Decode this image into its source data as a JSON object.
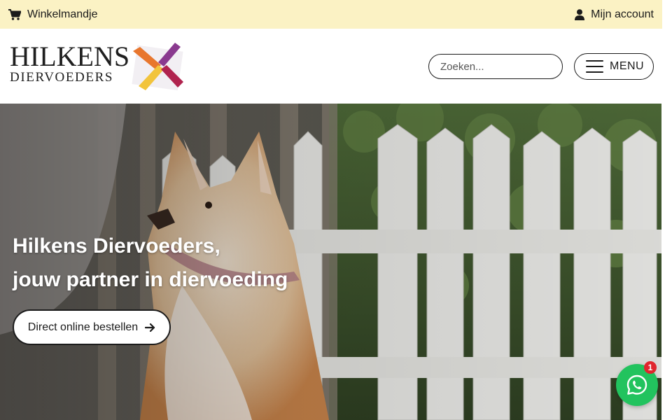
{
  "topbar": {
    "cart_label": "Winkelmandje",
    "cart_icon": "shopping-cart-icon",
    "account_label": "Mijn account",
    "account_icon": "user-icon",
    "background": "#fbf2c4"
  },
  "header": {
    "logo": {
      "line1": "HILKENS",
      "line2": "DIERVOEDERS",
      "mark_colors": [
        "#e8762d",
        "#8a3a8f",
        "#f2c43c",
        "#b0234e"
      ]
    },
    "search": {
      "placeholder": "Zoeken...",
      "icon": "search-icon"
    },
    "menu": {
      "label": "MENU",
      "icon": "hamburger-icon"
    }
  },
  "hero": {
    "title_line1": "Hilkens Diervoeders,",
    "title_line2": "jouw partner in diervoeding",
    "cta_label": "Direct online bestellen",
    "cta_icon": "arrow-right-icon",
    "image_subject": "dog in front of white picket fence"
  },
  "whatsapp": {
    "icon": "whatsapp-icon",
    "badge_count": "1",
    "color": "#22c35e",
    "badge_color": "#e0252d"
  }
}
